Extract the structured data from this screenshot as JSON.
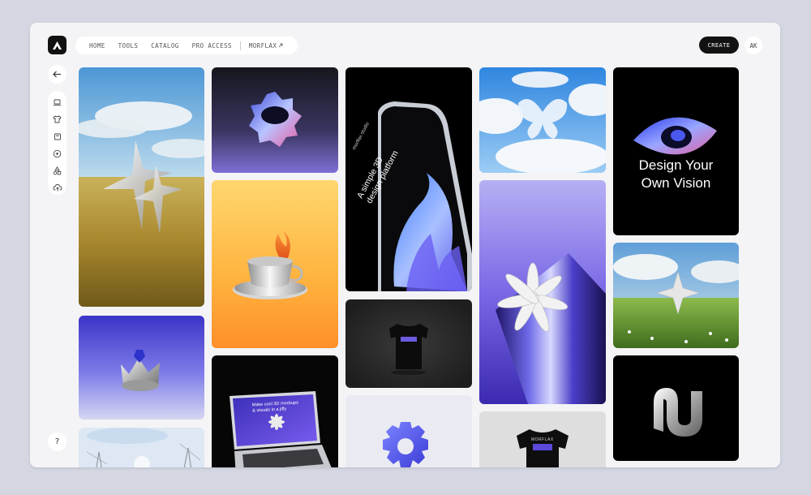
{
  "nav": {
    "items": [
      "HOME",
      "TOOLS",
      "CATALOG",
      "PRO ACCESS"
    ],
    "external": "MORFLAX",
    "create_label": "CREATE",
    "avatar_initials": "AK"
  },
  "sidebar": {
    "tools": [
      "laptop-icon",
      "tshirt-icon",
      "bag-icon",
      "sparkle-icon",
      "shapes-icon",
      "cloud-upload-icon"
    ],
    "help_label": "?"
  },
  "gallery": {
    "phone_brand": "morflax studio",
    "phone_headline_1": "A simple 3D",
    "phone_headline_2": "design platform",
    "vision_line1": "Design Your",
    "vision_line2": "Own Vision",
    "laptop_line1": "Make cool 3D mockups",
    "laptop_line2": "& visuals in a jiffy",
    "tshirt_print": "MORFLAX"
  },
  "colors": {
    "accent": "#121212",
    "background": "#d4d6e2",
    "panel": "#f4f4f6"
  }
}
